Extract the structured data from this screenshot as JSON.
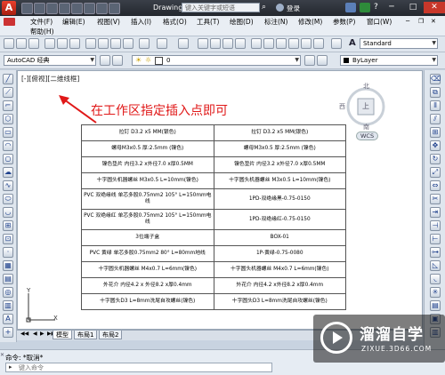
{
  "titlebar": {
    "app_logo": "A",
    "doc_title": "Drawing1...",
    "search_placeholder": "键入关键字或短语",
    "login_label": "登录",
    "minimize": "─",
    "maximize": "□",
    "close": "✕"
  },
  "menu": {
    "row1": [
      "文件(F)",
      "编辑(E)",
      "视图(V)",
      "插入(I)",
      "格式(O)",
      "工具(T)",
      "绘图(D)",
      "标注(N)",
      "修改(M)",
      "参数(P)",
      "窗口(W)"
    ],
    "row2": [
      "帮助(H)"
    ]
  },
  "toolbar": {
    "text_style": "Standard",
    "workspace": "AutoCAD 经典",
    "layer": "0",
    "color": "ByLayer"
  },
  "canvas": {
    "viewport_label": "[-][俯视][二维线框]",
    "annotation": "在工作区指定插入点即可",
    "viewcube": {
      "north": "北",
      "south": "南",
      "west": "西",
      "top": "上"
    },
    "wcs": "WCS"
  },
  "table_rows": [
    [
      "拉钉 D3.2 x5 MM(银色)",
      "拉钉 D3.2 x5 MM(银色)"
    ],
    [
      "螺母M3x0.5 厚:2.5mm (镍色)",
      "螺母M3x0.5 厚:2.5mm (镍色)"
    ],
    [
      "镍色垫片 内径3.2 x外径7.0 x厚0.5MM",
      "镍色垫片 内径3.2 x外径7.0 x厚0.5MM"
    ],
    [
      "十字圆头机器螺丝 M3x0.5 L=10mm(镍色)",
      "十字圆头机器螺丝 M3x0.5 L=10mm(镍色)"
    ],
    [
      "PVC 双绝缘线 单芯多股0.75mm2 105° L=150mm电线",
      "1PD-双绝缘黑-0.75-0150"
    ],
    [
      "PVC 双绝缘红 单芯多股0.75mm2 105° L=150mm电线",
      "1PD-双绝缘红-0.75-0150"
    ],
    [
      "3位端子盒",
      "BOX-01"
    ],
    [
      "PVC 黄绿 单芯多股0.75mm2 80° L=80mm地线",
      "1P-黄绿-0.75-0080"
    ],
    [
      "十字圆头机器螺丝 M4x0.7 L=6mm(镍色)",
      "十字圆头机器螺丝 M4x0.7 L=6mm(镍色)"
    ],
    [
      "外花介 内径4.2 x 外径8.2 x厚0.4mm",
      "外花介 内径4.2 x外径8.2 x厚0.4mm"
    ],
    [
      "十字圆头D3 L=8mm洗尾自攻螺丝(镍色)",
      "十字圆头D3 L=8mm洗尾自攻螺丝(镍色)"
    ]
  ],
  "ucs": {
    "y_label": "Y",
    "x_label": "X"
  },
  "tabs": [
    "模型",
    "布局1",
    "布局2"
  ],
  "command": {
    "history": "命令: *取消*",
    "placeholder": "键入命令"
  },
  "watermark": {
    "brand": "溜溜自学",
    "url": "ZIXUE.3D66.COM"
  },
  "colors": {
    "annotation_red": "#e01818",
    "title_bar": "#2a2e36",
    "close_red": "#c8372a"
  }
}
